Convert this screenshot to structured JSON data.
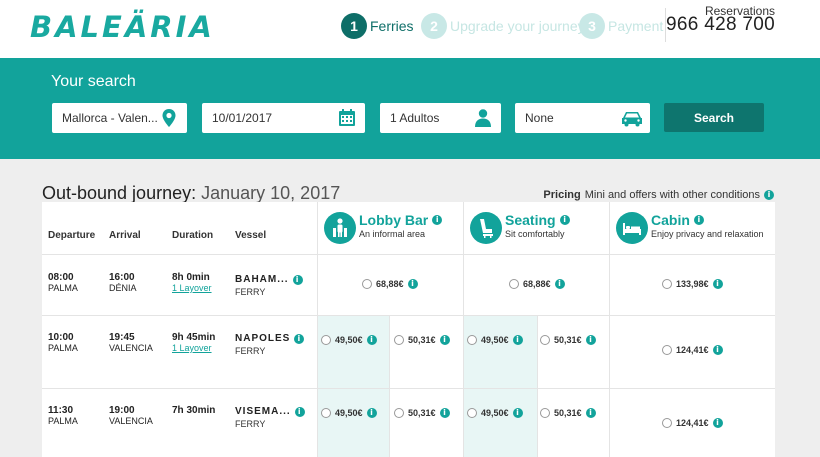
{
  "header": {
    "logo": "BALEÄRIA",
    "steps": [
      {
        "num": "1",
        "label": "Ferries"
      },
      {
        "num": "2",
        "label": "Upgrade your journey"
      },
      {
        "num": "3",
        "label": "Payment"
      }
    ],
    "reservations_label": "Reservations",
    "reservations_phone": "966 428 700"
  },
  "search": {
    "title": "Your search",
    "route": "Mallorca - Valen...",
    "date": "10/01/2017",
    "passengers": "1 Adultos",
    "vehicle": "None",
    "button": "Search"
  },
  "journey": {
    "title_prefix": "Out-bound journey:",
    "date": "January 10, 2017",
    "pricing_label": "Pricing",
    "pricing_text": "Mini and offers with other conditions"
  },
  "table": {
    "columns": [
      "Departure",
      "Arrival",
      "Duration",
      "Vessel"
    ],
    "classes": [
      {
        "name": "Lobby Bar",
        "sub": "An informal area",
        "icon": "person-icon"
      },
      {
        "name": "Seating",
        "sub": "Sit comfortably",
        "icon": "seat-icon"
      },
      {
        "name": "Cabin",
        "sub": "Enjoy privacy and relaxation",
        "icon": "bed-icon"
      }
    ],
    "rows": [
      {
        "dep_time": "08:00",
        "dep_place": "PALMA",
        "arr_time": "16:00",
        "arr_place": "DÉNIA",
        "duration": "8h 0min",
        "layover": "1 Layover",
        "vessel": "BAHAM...",
        "vessel_type": "FERRY",
        "lobby": [
          "68,88€"
        ],
        "seating": [
          "68,88€"
        ],
        "cabin": "133,98€"
      },
      {
        "dep_time": "10:00",
        "dep_place": "PALMA",
        "arr_time": "19:45",
        "arr_place": "VALENCIA",
        "duration": "9h 45min",
        "layover": "1 Layover",
        "vessel": "NAPOLES",
        "vessel_type": "FERRY",
        "lobby": [
          "49,50€",
          "50,31€"
        ],
        "seating": [
          "49,50€",
          "50,31€"
        ],
        "cabin": "124,41€"
      },
      {
        "dep_time": "11:30",
        "dep_place": "PALMA",
        "arr_time": "19:00",
        "arr_place": "VALENCIA",
        "duration": "7h 30min",
        "layover": "",
        "vessel": "VISEMA...",
        "vessel_type": "FERRY",
        "lobby": [
          "49,50€",
          "50,31€"
        ],
        "seating": [
          "49,50€",
          "50,31€"
        ],
        "cabin": "124,41€"
      }
    ]
  },
  "colors": {
    "brand": "#12a39b",
    "brand_dark": "#0e6e68",
    "highlight": "#e8f6f5"
  }
}
